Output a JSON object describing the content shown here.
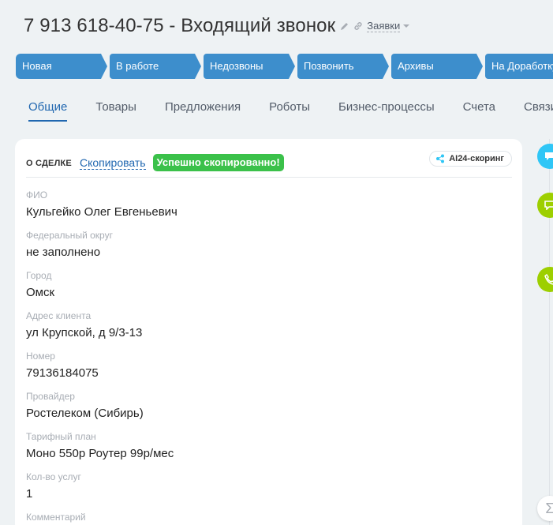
{
  "header": {
    "title": "7 913 618-40-75 - Входящий звонок",
    "category": "Заявки",
    "icons": [
      "pencil-icon",
      "link-icon",
      "chevron-down-icon"
    ]
  },
  "stages": [
    {
      "label": "Новая"
    },
    {
      "label": "В работе"
    },
    {
      "label": "Недозвоны"
    },
    {
      "label": "Позвонить"
    },
    {
      "label": "Архивы"
    },
    {
      "label": "На Доработку"
    }
  ],
  "stage_color": "#3d8ecc",
  "tabs": [
    {
      "label": "Общие",
      "active": true
    },
    {
      "label": "Товары"
    },
    {
      "label": "Предложения"
    },
    {
      "label": "Роботы"
    },
    {
      "label": "Бизнес-процессы"
    },
    {
      "label": "Счета"
    },
    {
      "label": "Связи"
    }
  ],
  "card": {
    "section_label": "О СДЕЛКЕ",
    "copy_label": "Скопировать",
    "copy_toast": "Успешно скопированно!",
    "ai_badge": "AI24-скоринг",
    "fields": [
      {
        "label": "ФИО",
        "value": "Кульгейко Олег Евгеньевич"
      },
      {
        "label": "Федеральный округ",
        "value": "не заполнено"
      },
      {
        "label": "Город",
        "value": "Омск"
      },
      {
        "label": "Адрес клиента",
        "value": "ул Крупской, д 9/3-13"
      },
      {
        "label": "Номер",
        "value": "79136184075"
      },
      {
        "label": "Провайдер",
        "value": "Ростелеком (Сибирь)"
      },
      {
        "label": "Тарифный план",
        "value": "Моно 550р Роутер 99р/мес"
      },
      {
        "label": "Кол-во услуг",
        "value": "1"
      },
      {
        "label": "Комментарий",
        "value": ""
      }
    ]
  },
  "side_buttons": [
    "chat-icon",
    "comment-icon",
    "phone-icon",
    "sum-icon"
  ],
  "colors": {
    "accent": "#2067b0",
    "success": "#3bc14a",
    "green": "#9dcf00",
    "cyan": "#2fc6f6"
  }
}
